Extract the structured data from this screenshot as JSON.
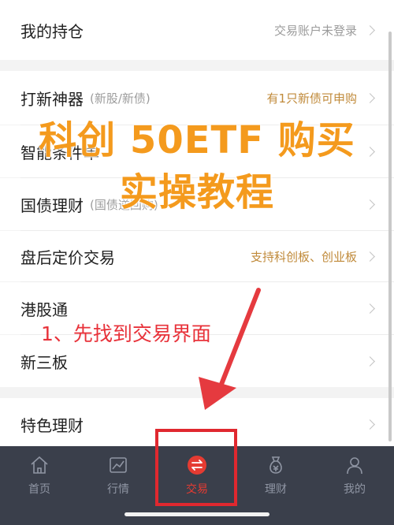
{
  "holdings": {
    "label": "我的持仓",
    "status": "交易账户未登录"
  },
  "menu": [
    {
      "label": "打新神器",
      "sub": "(新股/新债)",
      "right": "有1只新债可申购",
      "right_style": "gold"
    },
    {
      "label": "智能条件单",
      "sub": "",
      "right": "",
      "right_style": ""
    },
    {
      "label": "国债理财",
      "sub": "(国债逆回购)",
      "right": "",
      "right_style": ""
    },
    {
      "label": "盘后定价交易",
      "sub": "",
      "right": "支持科创板、创业板",
      "right_style": "gold"
    },
    {
      "label": "港股通",
      "sub": "",
      "right": "",
      "right_style": ""
    },
    {
      "label": "新三板",
      "sub": "",
      "right": "",
      "right_style": ""
    },
    {
      "label": "特色理财",
      "sub": "",
      "right": "",
      "right_style": ""
    }
  ],
  "overlay": {
    "title_line1": "科创 50ETF 购买",
    "title_line2": "实操教程",
    "step1": "1、先找到交易界面"
  },
  "tabbar": {
    "items": [
      {
        "label": "首页",
        "icon": "home-icon"
      },
      {
        "label": "行情",
        "icon": "chart-icon"
      },
      {
        "label": "交易",
        "icon": "trade-exchange-icon",
        "active": true
      },
      {
        "label": "理财",
        "icon": "money-bag-icon"
      },
      {
        "label": "我的",
        "icon": "user-icon"
      }
    ]
  },
  "colors": {
    "accent_gold": "#c08a3a",
    "overlay_orange": "#f49a1d",
    "annotation_red": "#e0282f",
    "tabbar_bg": "#3a3f4b",
    "tab_active": "#e53b32"
  }
}
